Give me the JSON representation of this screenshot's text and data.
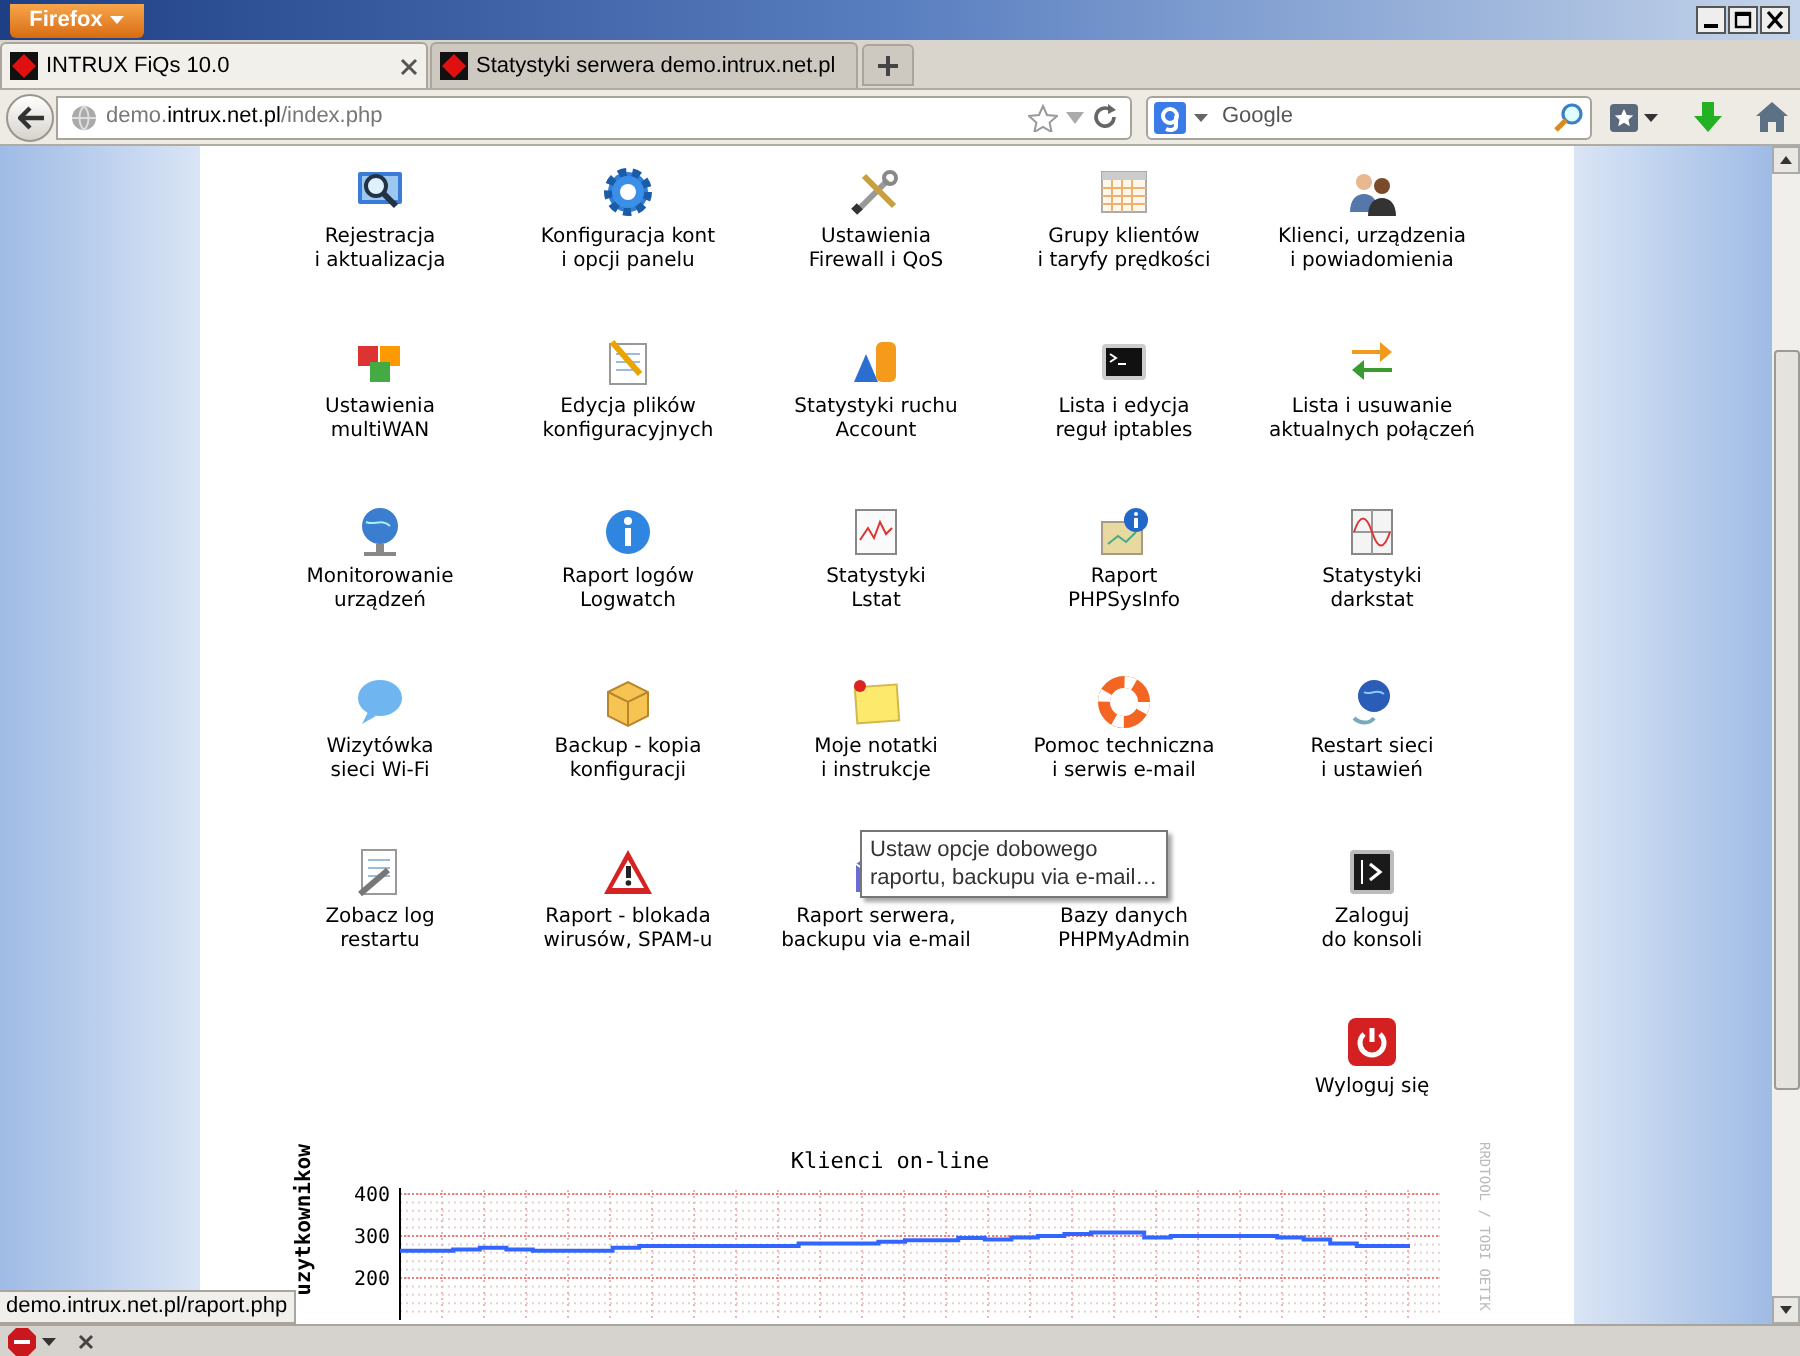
{
  "browser": {
    "menu_button": "Firefox",
    "tabs": [
      {
        "title": "INTRUX FiQs 10.0",
        "selected": true
      },
      {
        "title": "Statystyki serwera demo.intrux.net.pl",
        "selected": false
      }
    ],
    "address": {
      "prefix": "demo.",
      "domain": "intrux.net.pl",
      "path": "/index.php"
    },
    "search": {
      "placeholder": "Google"
    }
  },
  "menu": {
    "items": [
      {
        "lines": [
          "Rejestracja",
          "i aktualizacja"
        ]
      },
      {
        "lines": [
          "Konfiguracja kont",
          "i opcji panelu"
        ]
      },
      {
        "lines": [
          "Ustawienia",
          "Firewall i QoS"
        ]
      },
      {
        "lines": [
          "Grupy klientów",
          "i taryfy prędkości"
        ]
      },
      {
        "lines": [
          "Klienci, urządzenia",
          "i powiadomienia"
        ]
      },
      {
        "lines": [
          "Ustawienia",
          "multiWAN"
        ]
      },
      {
        "lines": [
          "Edycja plików",
          "konfiguracyjnych"
        ]
      },
      {
        "lines": [
          "Statystyki ruchu",
          "Account"
        ]
      },
      {
        "lines": [
          "Lista i edycja",
          "reguł iptables"
        ]
      },
      {
        "lines": [
          "Lista i usuwanie",
          "aktualnych połączeń"
        ]
      },
      {
        "lines": [
          "Monitorowanie",
          "urządzeń"
        ]
      },
      {
        "lines": [
          "Raport logów",
          "Logwatch"
        ]
      },
      {
        "lines": [
          "Statystyki",
          "Lstat"
        ]
      },
      {
        "lines": [
          "Raport",
          "PHPSysInfo"
        ]
      },
      {
        "lines": [
          "Statystyki",
          "darkstat"
        ]
      },
      {
        "lines": [
          "Wizytówka",
          "sieci Wi-Fi"
        ]
      },
      {
        "lines": [
          "Backup - kopia",
          "konfiguracji"
        ]
      },
      {
        "lines": [
          "Moje notatki",
          "i instrukcje"
        ]
      },
      {
        "lines": [
          "Pomoc techniczna",
          "i serwis e-mail"
        ]
      },
      {
        "lines": [
          "Restart sieci",
          "i ustawień"
        ]
      },
      {
        "lines": [
          "Zobacz log",
          "restartu"
        ]
      },
      {
        "lines": [
          "Raport - blokada",
          "wirusów, SPAM-u"
        ]
      },
      {
        "lines": [
          "Raport serwera,",
          "backupu via e-mail"
        ]
      },
      {
        "lines": [
          "Bazy danych",
          "PHPMyAdmin"
        ],
        "covered": true
      },
      {
        "lines": [
          "Zaloguj",
          "do konsoli"
        ]
      },
      {
        "lines": [
          "Wyloguj się"
        ]
      }
    ]
  },
  "tooltip": {
    "lines": [
      "Ustaw opcje dobowego",
      "raportu, backupu via e-mail…"
    ]
  },
  "chart": {
    "credit": "RRDTOOL / TOBI OETIK",
    "chart_data": {
      "type": "line",
      "grid": true,
      "title": "Klienci on-line",
      "ylabel": "uzytkownikow",
      "ylim": [
        100,
        400
      ],
      "yticks": [
        200,
        300,
        400
      ],
      "series": [
        {
          "color": "#3366ff",
          "values": [
            265,
            265,
            268,
            272,
            268,
            265,
            265,
            265,
            272,
            276,
            276,
            276,
            276,
            276,
            276,
            282,
            282,
            282,
            286,
            290,
            290,
            295,
            292,
            296,
            300,
            305,
            308,
            308,
            296,
            300,
            300,
            300,
            300,
            296,
            292,
            282,
            276,
            276
          ]
        }
      ]
    }
  },
  "status_link": "demo.intrux.net.pl/raport.php"
}
